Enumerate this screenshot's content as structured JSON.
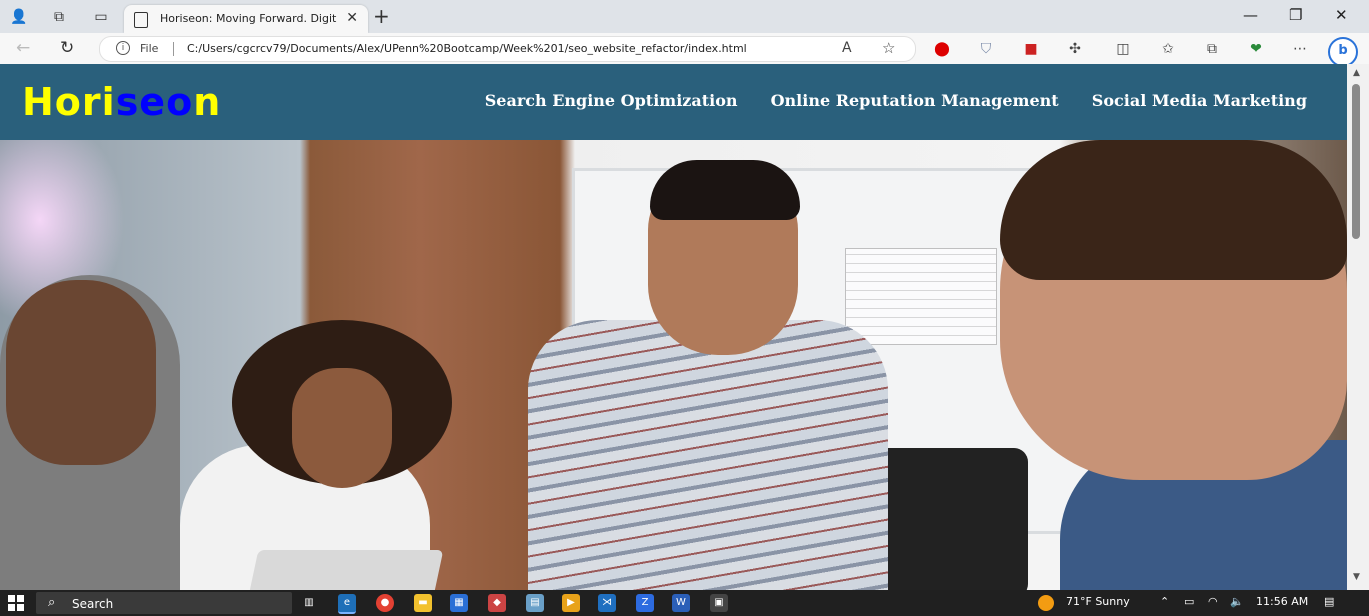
{
  "browser": {
    "tab_title": "Horiseon: Moving Forward. Digit",
    "tab_close": "✕",
    "new_tab": "+",
    "address_file_label": "File",
    "url": "C:/Users/cgcrcv79/Documents/Alex/UPenn%20Bootcamp/Week%201/seo_website_refactor/index.html"
  },
  "site": {
    "logo_part1": "Hori",
    "logo_part2": "seo",
    "logo_part3": "n",
    "nav": [
      {
        "label": "Search Engine Optimization"
      },
      {
        "label": "Online Reputation Management"
      },
      {
        "label": "Social Media Marketing"
      }
    ]
  },
  "taskbar": {
    "search_label": "Search",
    "weather": "71°F  Sunny",
    "time": "11:56 AM"
  },
  "colors": {
    "header_bg": "#2a607c",
    "logo_yellow": "#ffff00",
    "logo_blue": "#0000ff"
  }
}
